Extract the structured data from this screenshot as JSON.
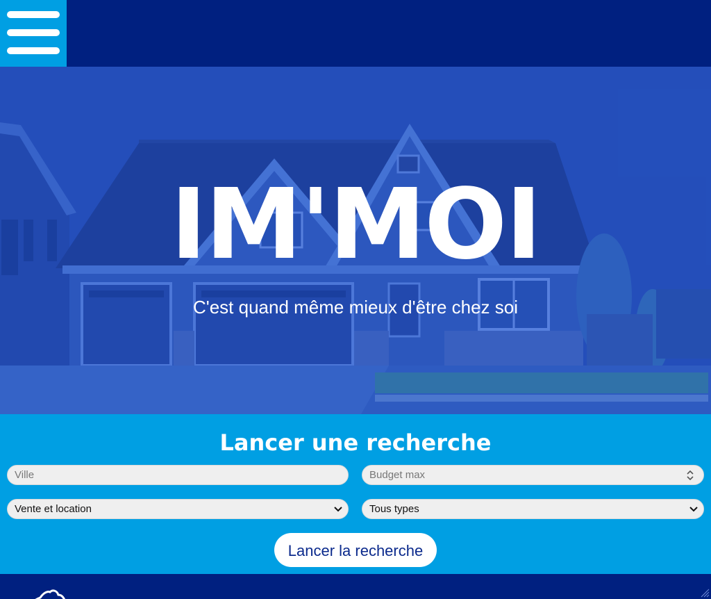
{
  "header": {
    "menu_icon": "hamburger-menu-icon"
  },
  "hero": {
    "title": "IM'MOI",
    "subtitle": "C'est quand même mieux d'être chez soi",
    "background": "house-photo"
  },
  "search": {
    "title": "Lancer une recherche",
    "city_placeholder": "Ville",
    "budget_placeholder": "Budget max",
    "transaction_selected": "Vente et location",
    "type_selected": "Tous types",
    "submit_label": "Lancer la recherche"
  },
  "footer": {
    "logo_icon": "map-logo-icon"
  },
  "colors": {
    "primary_dark": "#002080",
    "accent": "#009FE3",
    "white": "#FFFFFF"
  }
}
